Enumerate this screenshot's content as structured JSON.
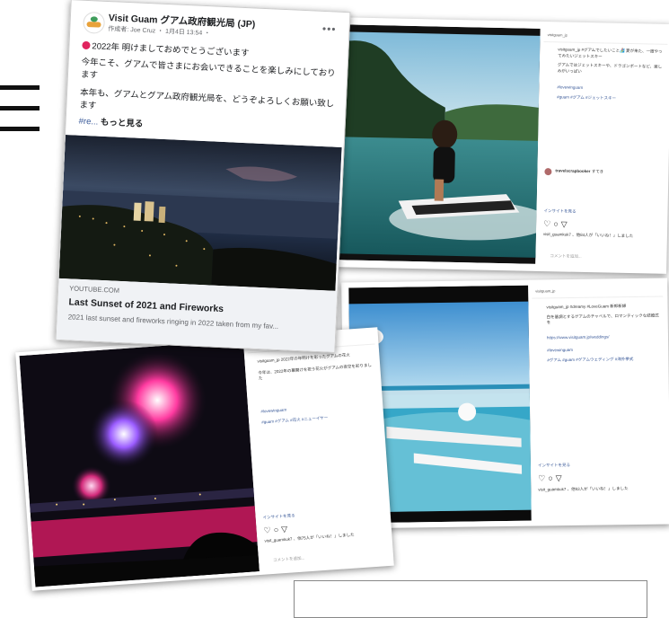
{
  "menu": {
    "icon": "hamburger-menu-icon"
  },
  "facebook_post": {
    "page_name": "Visit Guam グアム政府観光局 (JP)",
    "author_line": "作成者: Joe Cruz ・ 1月4日 13:54 ・",
    "more_icon": "ellipsis-icon",
    "line1": "2022年 明けましておめでとうございます",
    "line2": "今年こそ、グアムで皆さまにお会いできることを楽しみにしております",
    "line3": "本年も、グアムとグアム政府観光局を、どうぞよろしくお願い致します",
    "hashtag": "#re...",
    "see_more": "もっと見る",
    "link_domain": "YOUTUBE.COM",
    "link_title": "Last Sunset of 2021 and Fireworks",
    "link_desc": "2021 last sunset and fireworks ringing in 2022 taken from my fav..."
  },
  "ig_jetski": {
    "account": "visitguam_jp",
    "caption": "visitguam_jp #グアムでしたいこと🏄‍♀️ 夏が来た、一度やってみたいジェットスキー",
    "body": "グアムではジェットスキーや、ドラゴンボートなど、楽しみがいっぱい",
    "hashtag": "#lovewinguam",
    "link": "#guam #グアム #ジェットスキー",
    "comment_user": "travelscrapbooker",
    "comment_text": "すてき",
    "translate": "インサイトを見る",
    "likes": "visit_guamkuk7 、他84人が「いいね！」しました",
    "comment_placeholder": "コメントを追加..."
  },
  "ig_wedding": {
    "account": "visitguam_jp",
    "caption": "visitguam_jp #dreamy #LoveGuam 新郎新婦",
    "body": "白を基調とするグアムのチャペルで、ロマンティックな結婚式を",
    "url": "https://www.visitguam.jp/weddings/",
    "hashtag": "#lovewinguam",
    "link": "#グアム #guam #グアムウェディング #海外挙式",
    "translate": "インサイトを見る",
    "likes": "visit_guamkuk7 、他93人が「いいね！」しました"
  },
  "ig_fireworks": {
    "account": "visitguam_jp",
    "caption": "visitguam_jp 2022年の年明けを彩ったグアムの花火",
    "body": "今年は、2022年の幕開けを祝う花火がグアムの夜空を彩りました",
    "hashtag": "#lovewinguam",
    "link": "#guam #グアム #花火 #ニューイヤー",
    "translate": "インサイトを見る",
    "likes": "visit_guamkuk7 、他75人が「いいね！」しました",
    "comment_placeholder": "コメントを追加..."
  },
  "colors": {
    "fb_blue": "#385898",
    "reaction_red": "#e0245e",
    "ig_link": "#385898"
  }
}
